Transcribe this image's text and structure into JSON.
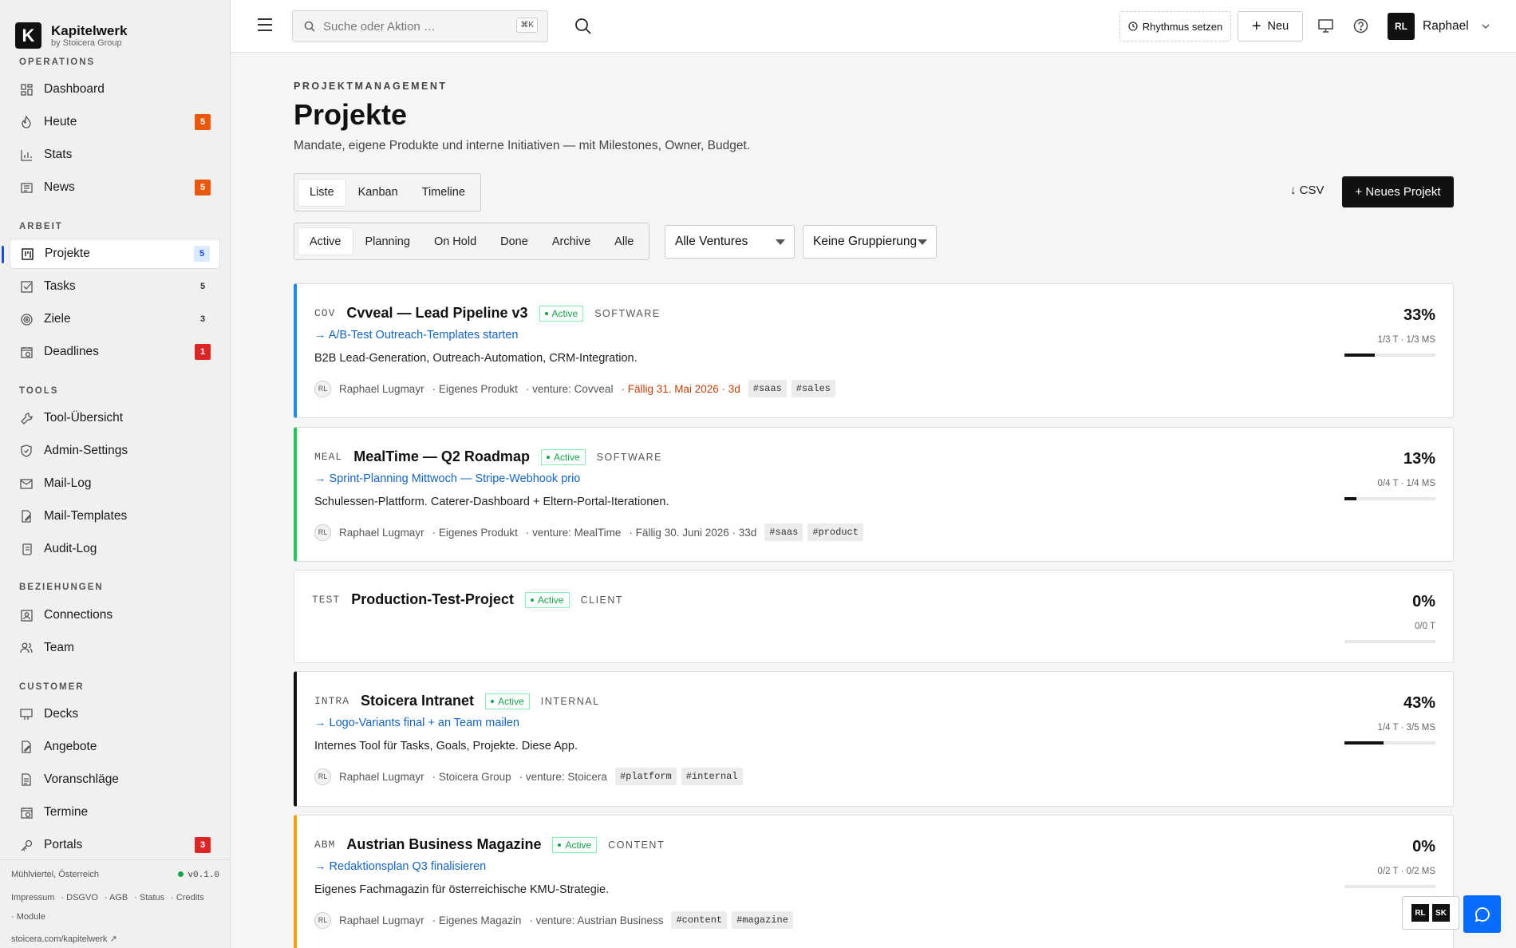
{
  "brand": {
    "name": "Kapitelwerk",
    "sub": "by Stoicera Group",
    "logo_letter": "K"
  },
  "sidebar": {
    "sections": {
      "operations": "OPERATIONS",
      "arbeit": "ARBEIT",
      "tools": "TOOLS",
      "beziehungen": "BEZIEHUNGEN",
      "customer": "CUSTOMER"
    },
    "items": [
      {
        "label": "Dashboard",
        "icon": "grid-icon",
        "badge": ""
      },
      {
        "label": "Heute",
        "icon": "flame-icon",
        "badge": "5"
      },
      {
        "label": "Stats",
        "icon": "bar-chart-icon",
        "badge": ""
      },
      {
        "label": "News",
        "icon": "newspaper-icon",
        "badge": "5"
      },
      {
        "label": "Projekte",
        "icon": "kanban-icon",
        "badge": "5"
      },
      {
        "label": "Tasks",
        "icon": "check-square-icon",
        "badge": "5"
      },
      {
        "label": "Ziele",
        "icon": "target-icon",
        "badge": "3"
      },
      {
        "label": "Deadlines",
        "icon": "calendar-clock-icon",
        "badge": "1"
      },
      {
        "label": "Tool-Übersicht",
        "icon": "wrench-icon",
        "badge": ""
      },
      {
        "label": "Admin-Settings",
        "icon": "shield-icon",
        "badge": ""
      },
      {
        "label": "Mail-Log",
        "icon": "mail-icon",
        "badge": ""
      },
      {
        "label": "Mail-Templates",
        "icon": "file-edit-icon",
        "badge": ""
      },
      {
        "label": "Audit-Log",
        "icon": "scroll-icon",
        "badge": ""
      },
      {
        "label": "Connections",
        "icon": "contact-icon",
        "badge": ""
      },
      {
        "label": "Team",
        "icon": "users-icon",
        "badge": ""
      },
      {
        "label": "Decks",
        "icon": "presentation-icon",
        "badge": ""
      },
      {
        "label": "Angebote",
        "icon": "file-pen-icon",
        "badge": ""
      },
      {
        "label": "Voranschläge",
        "icon": "file-text-icon",
        "badge": ""
      },
      {
        "label": "Termine",
        "icon": "calendar-icon",
        "badge": ""
      },
      {
        "label": "Portals",
        "icon": "key-icon",
        "badge": "3"
      }
    ],
    "footer": {
      "location": "Mühlviertel, Österreich",
      "version": "v0.1.0",
      "links": [
        "Impressum",
        "DSGVO",
        "AGB",
        "Status",
        "Credits",
        "Module"
      ],
      "url": "stoicera.com/kapitelwerk ↗"
    }
  },
  "topbar": {
    "search_placeholder": "Suche oder Aktion …",
    "search_kbd": "⌘K",
    "rhythm_label": "Rhythmus setzen",
    "new_label": "Neu",
    "user_initials": "RL",
    "user_name": "Raphael"
  },
  "page": {
    "eyebrow": "PROJEKTMANAGEMENT",
    "title": "Projekte",
    "subtitle": "Mandate, eigene Produkte und interne Initiativen — mit Milestones, Owner, Budget.",
    "view_tabs": [
      "Liste",
      "Kanban",
      "Timeline"
    ],
    "status_tabs": [
      "Active",
      "Planning",
      "On Hold",
      "Done",
      "Archive",
      "Alle"
    ],
    "venture_select": "Alle Ventures",
    "group_select": "Keine Gruppierung",
    "csv_label": "↓ CSV",
    "new_project_label": "+ Neues Projekt"
  },
  "projects": [
    {
      "code": "COV",
      "name": "Cvveal — Lead Pipeline v3",
      "status": "Active",
      "type": "SOFTWARE",
      "next": "→ A/B-Test Outreach-Templates starten",
      "desc": "B2B Lead-Generation, Outreach-Automation, CRM-Integration.",
      "owner_initials": "RL",
      "owner": "Raphael Lugmayr",
      "kind": "· Eigenes Produkt",
      "venture": "· venture: Covveal",
      "due": "· Fällig 31. Mai 2026 · 3d",
      "tags": [
        "#saas",
        "#sales"
      ],
      "pct": "33%",
      "stats": "1/3 T · 1/3 MS",
      "progress": 0.33,
      "accent": "#1e88e5"
    },
    {
      "code": "MEAL",
      "name": "MealTime — Q2 Roadmap",
      "status": "Active",
      "type": "SOFTWARE",
      "next": "→ Sprint-Planning Mittwoch — Stripe-Webhook prio",
      "desc": "Schulessen-Plattform. Caterer-Dashboard + Eltern-Portal-Iterationen.",
      "owner_initials": "RL",
      "owner": "Raphael Lugmayr",
      "kind": "· Eigenes Produkt",
      "venture": "· venture: MealTime",
      "due": "· Fällig 30. Juni 2026 · 33d",
      "tags": [
        "#saas",
        "#product"
      ],
      "pct": "13%",
      "stats": "0/4 T · 1/4 MS",
      "progress": 0.13,
      "accent": "#22c55e"
    },
    {
      "code": "TEST",
      "name": "Production-Test-Project",
      "status": "Active",
      "type": "CLIENT",
      "pct": "0%",
      "stats": "0/0 T",
      "progress": 0
    },
    {
      "code": "INTRA",
      "name": "Stoicera Intranet",
      "status": "Active",
      "type": "INTERNAL",
      "next": "→ Logo-Variants final + an Team mailen",
      "desc": "Internes Tool für Tasks, Goals, Projekte. Diese App.",
      "owner_initials": "RL",
      "owner": "Raphael Lugmayr",
      "kind": "· Stoicera Group",
      "venture": "· venture: Stoicera",
      "tags": [
        "#platform",
        "#internal"
      ],
      "pct": "43%",
      "stats": "1/4 T · 3/5 MS",
      "progress": 0.43,
      "accent": "#111111"
    },
    {
      "code": "ABM",
      "name": "Austrian Business Magazine",
      "status": "Active",
      "type": "CONTENT",
      "next": "→ Redaktionsplan Q3 finalisieren",
      "desc": "Eigenes Fachmagazin für österreichische KMU-Strategie.",
      "owner_initials": "RL",
      "owner": "Raphael Lugmayr",
      "kind": "· Eigenes Magazin",
      "venture": "· venture: Austrian Business",
      "tags": [
        "#content",
        "#magazine"
      ],
      "pct": "0%",
      "stats": "0/2 T · 0/2 MS",
      "progress": 0,
      "accent": "#f59e0b"
    }
  ],
  "presence": [
    "RL",
    "SK"
  ]
}
